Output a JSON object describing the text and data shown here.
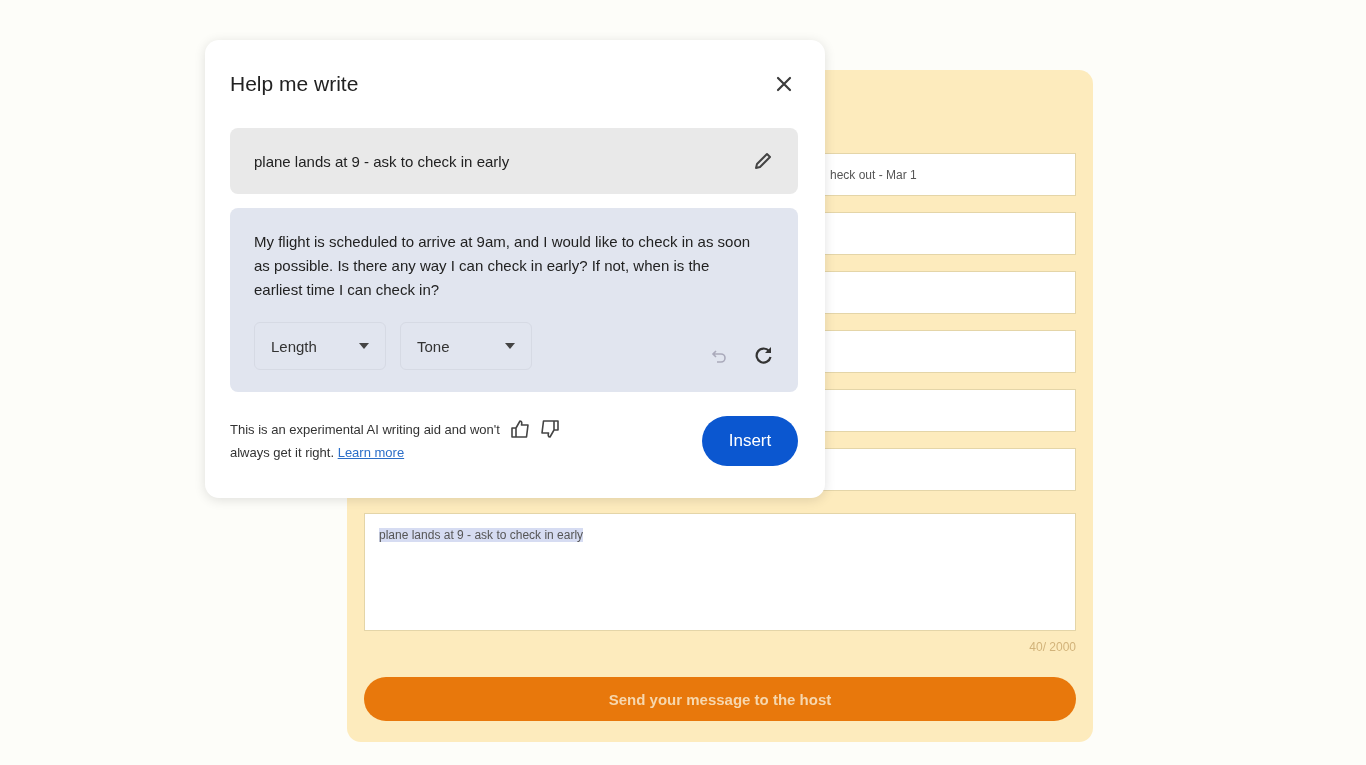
{
  "dialog": {
    "title": "Help me write",
    "prompt": "plane lands at 9 - ask to check in early",
    "draft": "My flight is scheduled to arrive at 9am, and I would like to check in as soon as possible. Is there any way I can check in early? If not, when is the earliest time I can check in?",
    "options": [
      {
        "label": "Length"
      },
      {
        "label": "Tone"
      }
    ],
    "disclaimer": "This is an experimental AI writing aid and won't always get it right.",
    "learn_more": "Learn more",
    "insert_button": "Insert"
  },
  "form": {
    "fields": [
      {
        "kind": "text",
        "value": "heck out - Mar 1"
      },
      {
        "kind": "text"
      },
      {
        "kind": "text"
      },
      {
        "kind": "text"
      },
      {
        "kind": "text"
      },
      {
        "kind": "text"
      }
    ],
    "message": {
      "value": "plane lands at 9 - ask to check in early",
      "highlighted": true
    },
    "counter": "40/ 2000",
    "send_button": "Send your message to the host"
  }
}
